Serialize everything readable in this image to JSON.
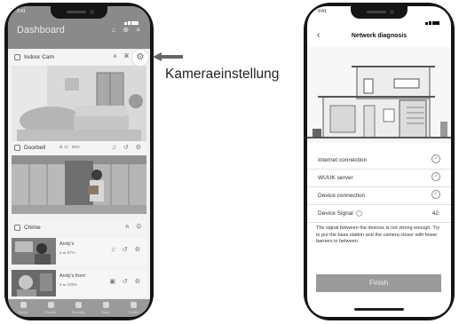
{
  "left_phone": {
    "status_time": "9:41",
    "header": {
      "title": "Dashboard"
    },
    "cameras": [
      {
        "name": "Indoor Cam"
      },
      {
        "name": "Doorbell",
        "battery": "99%"
      },
      {
        "name": "Chime"
      }
    ],
    "mini_cameras": [
      {
        "name": "Andy's",
        "battery": "87%"
      },
      {
        "name": "Andy's front",
        "battery": "100%"
      }
    ],
    "tabs": [
      "Home",
      "Events",
      "Security",
      "Store",
      "Profile"
    ]
  },
  "callout": {
    "text": "Kameraeinstellung"
  },
  "right_phone": {
    "status_time": "9:41",
    "title": "Network diagnosis",
    "rows": [
      {
        "label": "Internet connection",
        "status": "ok"
      },
      {
        "label": "WUUK server",
        "status": "ok"
      },
      {
        "label": "Device connection",
        "status": "ok"
      },
      {
        "label": "Device Signal",
        "value": "42"
      }
    ],
    "message": "The signal between the devices is not strong enough. Try to put the base station and the camera closer with fewer barriers in between.",
    "finish_label": "Finish"
  },
  "colors": {
    "header_gray": "#8a8a8a",
    "finish_gray": "#9a9a9a",
    "text_dark": "#222222"
  },
  "icons": [
    "settings-gear-icon",
    "share-icon",
    "history-icon",
    "bell-icon",
    "check-circle-icon",
    "info-icon",
    "back-chevron-icon"
  ]
}
